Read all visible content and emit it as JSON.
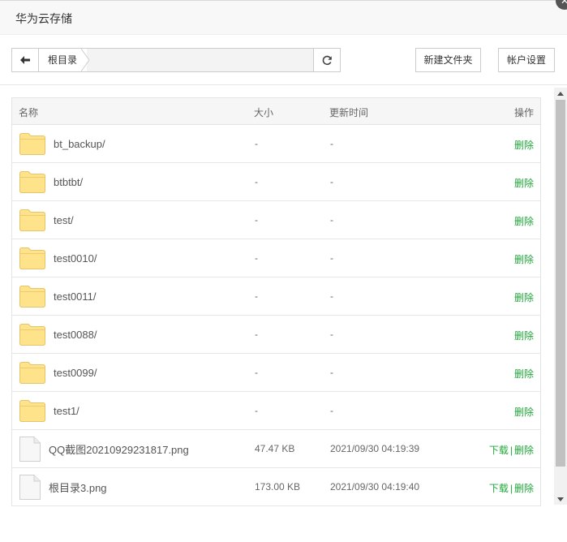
{
  "window": {
    "title": "华为云存储",
    "close_glyph": "✕"
  },
  "toolbar": {
    "breadcrumb": "根目录",
    "new_folder_label": "新建文件夹",
    "account_settings_label": "帐户设置"
  },
  "table": {
    "headers": {
      "name": "名称",
      "size": "大小",
      "mtime": "更新时间",
      "ops": "操作"
    },
    "rows": [
      {
        "type": "folder",
        "name": "bt_backup/",
        "size": "-",
        "mtime": "-",
        "download": "",
        "delete": "删除"
      },
      {
        "type": "folder",
        "name": "btbtbt/",
        "size": "-",
        "mtime": "-",
        "download": "",
        "delete": "删除"
      },
      {
        "type": "folder",
        "name": "test/",
        "size": "-",
        "mtime": "-",
        "download": "",
        "delete": "删除"
      },
      {
        "type": "folder",
        "name": "test0010/",
        "size": "-",
        "mtime": "-",
        "download": "",
        "delete": "删除"
      },
      {
        "type": "folder",
        "name": "test0011/",
        "size": "-",
        "mtime": "-",
        "download": "",
        "delete": "删除"
      },
      {
        "type": "folder",
        "name": "test0088/",
        "size": "-",
        "mtime": "-",
        "download": "",
        "delete": "删除"
      },
      {
        "type": "folder",
        "name": "test0099/",
        "size": "-",
        "mtime": "-",
        "download": "",
        "delete": "删除"
      },
      {
        "type": "folder",
        "name": "test1/",
        "size": "-",
        "mtime": "-",
        "download": "",
        "delete": "删除"
      },
      {
        "type": "file",
        "name": "QQ截图20210929231817.png",
        "size": "47.47 KB",
        "mtime": "2021/09/30 04:19:39",
        "download": "下载",
        "delete": "删除"
      },
      {
        "type": "file",
        "name": "根目录3.png",
        "size": "173.00 KB",
        "mtime": "2021/09/30 04:19:40",
        "download": "下载",
        "delete": "删除"
      }
    ]
  },
  "colors": {
    "accent_green": "#20a53a",
    "folder_fill": "#ffe38a",
    "folder_edge": "#e6c46a"
  },
  "icons": {
    "back": "arrow-left-icon",
    "refresh": "refresh-icon",
    "folder": "folder-icon",
    "file": "file-icon",
    "close": "close-icon"
  }
}
